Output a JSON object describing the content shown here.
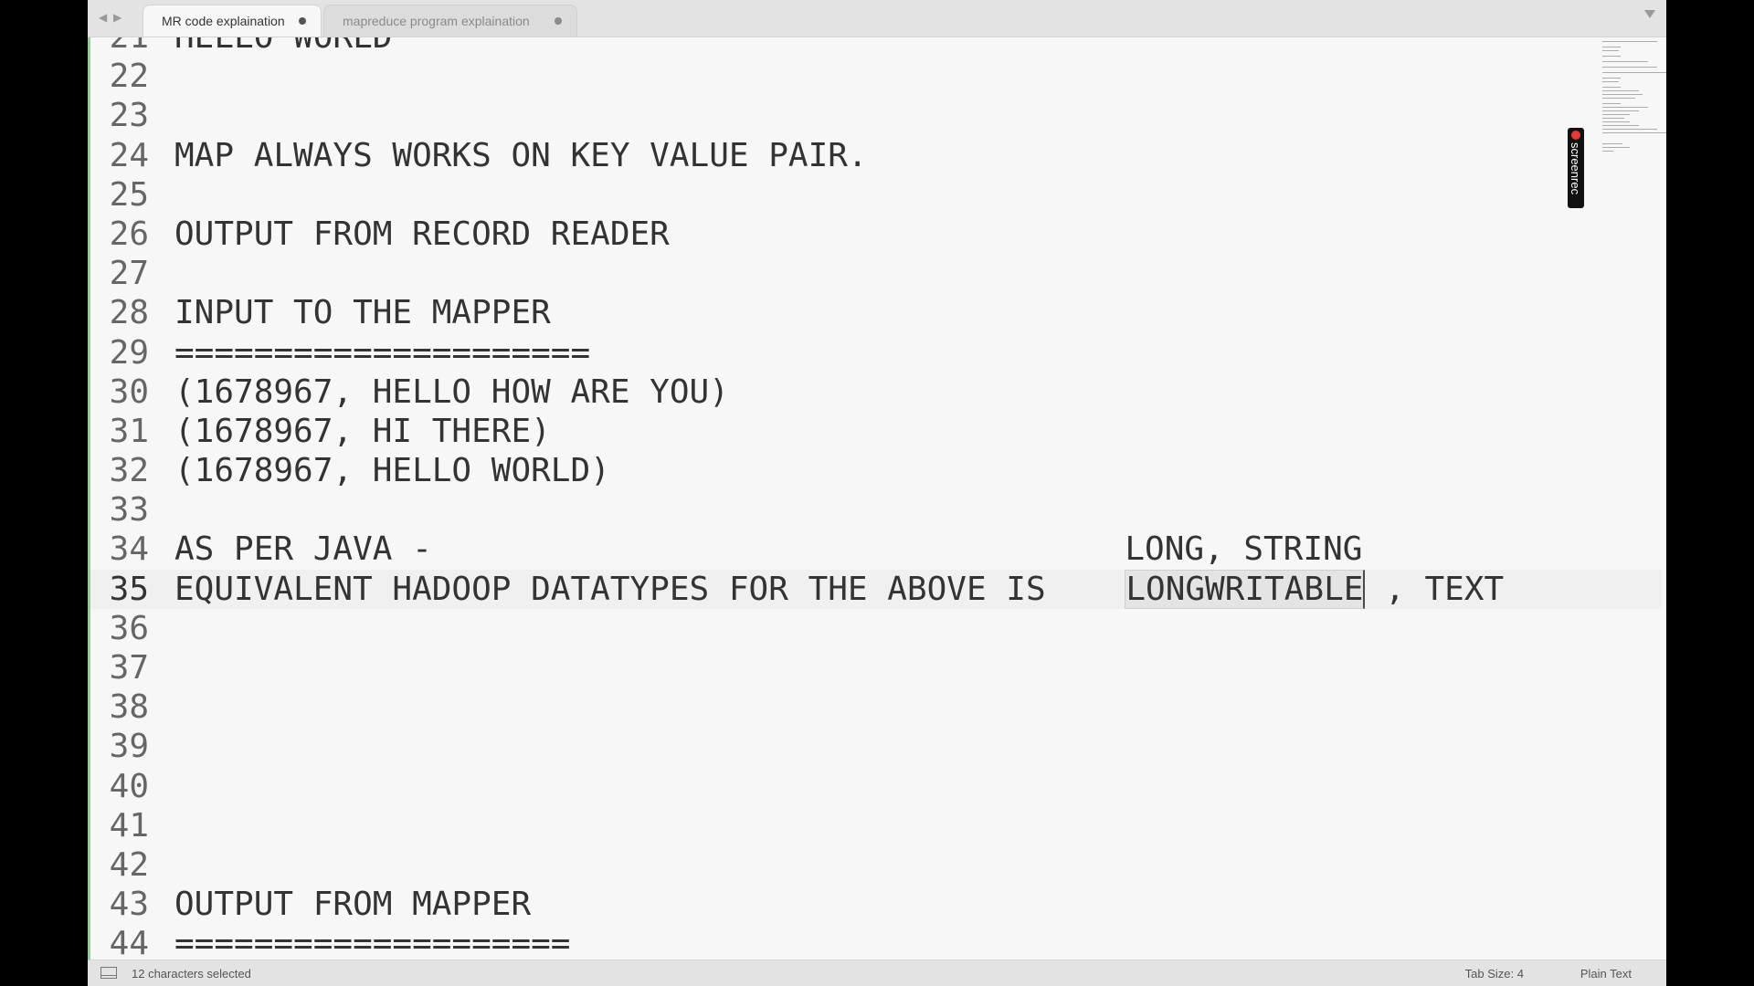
{
  "tabs": [
    {
      "label": "MR code explaination",
      "active": true,
      "dirty": true
    },
    {
      "label": "mapreduce program explaination",
      "active": false,
      "dirty": true
    }
  ],
  "nav": {
    "back": "◀",
    "forward": "▶"
  },
  "editor": {
    "current_line": 35,
    "lines": [
      {
        "n": "21",
        "text": "HELLO WORLD"
      },
      {
        "n": "22",
        "text": ""
      },
      {
        "n": "23",
        "text": ""
      },
      {
        "n": "24",
        "text": "MAP ALWAYS WORKS ON KEY VALUE PAIR."
      },
      {
        "n": "25",
        "text": ""
      },
      {
        "n": "26",
        "text": "OUTPUT FROM RECORD READER"
      },
      {
        "n": "27",
        "text": ""
      },
      {
        "n": "28",
        "text": "INPUT TO THE MAPPER"
      },
      {
        "n": "29",
        "text": "====================="
      },
      {
        "n": "30",
        "text": "(1678967, HELLO HOW ARE YOU)"
      },
      {
        "n": "31",
        "text": "(1678967, HI THERE)"
      },
      {
        "n": "32",
        "text": "(1678967, HELLO WORLD)"
      },
      {
        "n": "33",
        "text": ""
      },
      {
        "n": "34",
        "text": "AS PER JAVA -                                   LONG, STRING"
      },
      {
        "n": "35",
        "before": "EQUIVALENT HADOOP DATATYPES FOR THE ABOVE IS    ",
        "selected": "LONGWRITABLE",
        "after": " , TEXT"
      },
      {
        "n": "36",
        "text": ""
      },
      {
        "n": "37",
        "text": ""
      },
      {
        "n": "38",
        "text": ""
      },
      {
        "n": "39",
        "text": ""
      },
      {
        "n": "40",
        "text": ""
      },
      {
        "n": "41",
        "text": ""
      },
      {
        "n": "42",
        "text": ""
      },
      {
        "n": "43",
        "text": "OUTPUT FROM MAPPER"
      },
      {
        "n": "44",
        "text": "===================="
      }
    ]
  },
  "overlay": {
    "screenrec_label": "screenrec"
  },
  "status": {
    "selection": "12 characters selected",
    "tab_size": "Tab Size: 4",
    "syntax": "Plain Text"
  }
}
